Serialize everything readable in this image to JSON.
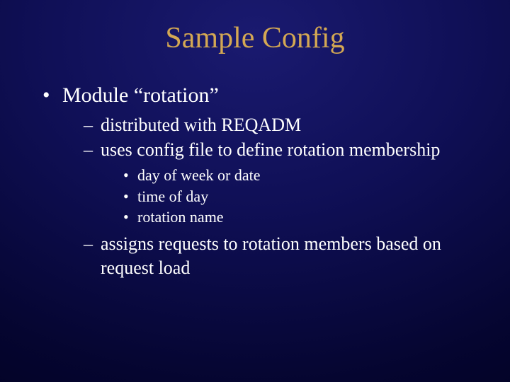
{
  "slide": {
    "title": "Sample Config",
    "bullets": {
      "lvl1_0": "Module “rotation”",
      "lvl2_0": "distributed with REQADM",
      "lvl2_1": "uses config file to define rotation membership",
      "lvl3_0": "day of week or date",
      "lvl3_1": "time of day",
      "lvl3_2": "rotation name",
      "lvl2_2": "assigns requests to rotation members based on request load"
    }
  }
}
